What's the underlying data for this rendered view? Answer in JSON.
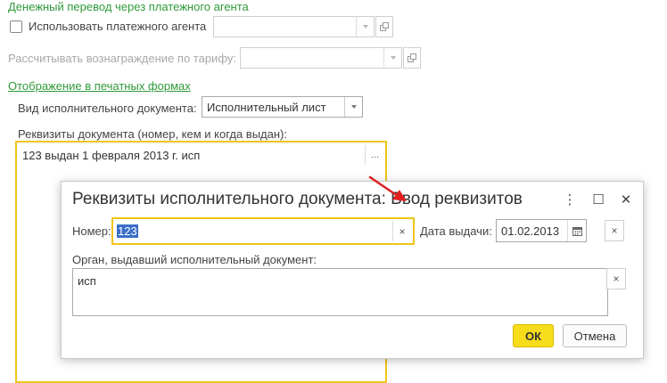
{
  "form": {
    "section_money_transfer": "Денежный перевод через платежного агента",
    "use_agent_label": "Использовать платежного агента",
    "use_agent_checked": false,
    "agent_value": "",
    "tariff_label": "Рассчитывать вознаграждение по тарифу:",
    "tariff_value": "",
    "section_print": "Отображение в печатных формах",
    "doc_type_label": "Вид исполнительного документа:",
    "doc_type_value": "Исполнительный лист",
    "requisites_label": "Реквизиты документа (номер, кем и когда выдан):",
    "requisites_value": "123 выдан 1 февраля 2013 г. исп",
    "ellipsis": "..."
  },
  "dialog": {
    "title": "Реквизиты исполнительного документа: Ввод реквизитов",
    "menu_glyph": "⋮",
    "maximize_glyph": "☐",
    "close_glyph": "✕",
    "number_label": "Номер:",
    "number_value": "123",
    "clear_glyph": "×",
    "issue_date_label": "Дата выдачи:",
    "issue_date_value": "01.02.2013",
    "issuer_label": "Орган, выдавший исполнительный документ:",
    "issuer_value": "исп",
    "ok_label": "ОК",
    "cancel_label": "Отмена"
  },
  "colors": {
    "accent_yellow": "#f6dc1b",
    "section_green": "#2f9a3a",
    "arrow_red": "#e02020",
    "selection_blue": "#3a6ec9"
  }
}
